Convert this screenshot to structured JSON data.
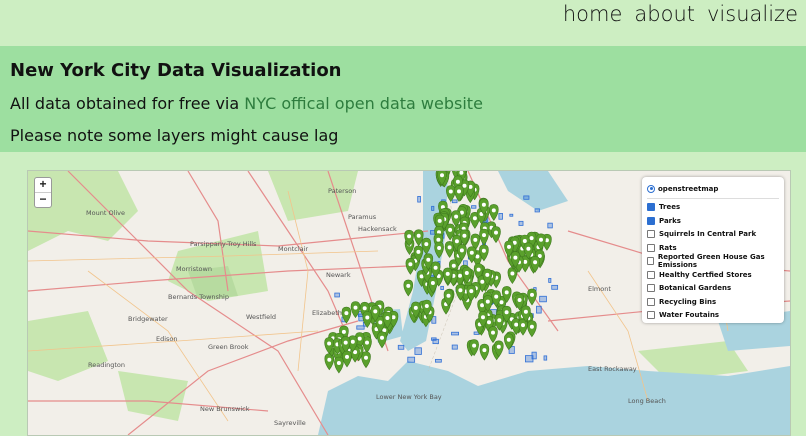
{
  "nav": {
    "home": "home",
    "about": "about",
    "visualize": "visualize"
  },
  "banner": {
    "title": "New York City Data Visualization",
    "line2_prefix": "All data obtained for free via ",
    "line2_link": "NYC offical open data website",
    "line3": "Please note some layers might cause lag"
  },
  "map": {
    "zoom_in": "+",
    "zoom_out": "−",
    "base_layer": "openstreetmap",
    "overlays": [
      {
        "label": "Trees",
        "checked": true
      },
      {
        "label": "Parks",
        "checked": true
      },
      {
        "label": "Squirrels In Central Park",
        "checked": false
      },
      {
        "label": "Rats",
        "checked": false
      },
      {
        "label": "Reported Green House Gas Emissions",
        "checked": false
      },
      {
        "label": "Healthy Certfied Stores",
        "checked": false
      },
      {
        "label": "Botanical Gardens",
        "checked": false
      },
      {
        "label": "Recycling Bins",
        "checked": false
      },
      {
        "label": "Water Foutains",
        "checked": false
      }
    ],
    "place_labels": [
      "Paterson",
      "Mount Olive",
      "Paramus",
      "Hackensack",
      "Parsippany-Troy Hills",
      "Morristown",
      "Newark",
      "Elizabeth",
      "Westfield",
      "Edison",
      "New Brunswick",
      "Bernards Township",
      "Green Brook",
      "Readington",
      "Bridgewater",
      "Montclair",
      "Elmont",
      "Lower New York Bay",
      "Long Beach",
      "Sayreville",
      "East Rockaway"
    ],
    "colors": {
      "marker": "#5aa02c",
      "parks": "#2f6fd6",
      "water": "#aad3df",
      "land": "#f2efe9",
      "green": "#c8e6b0"
    }
  }
}
